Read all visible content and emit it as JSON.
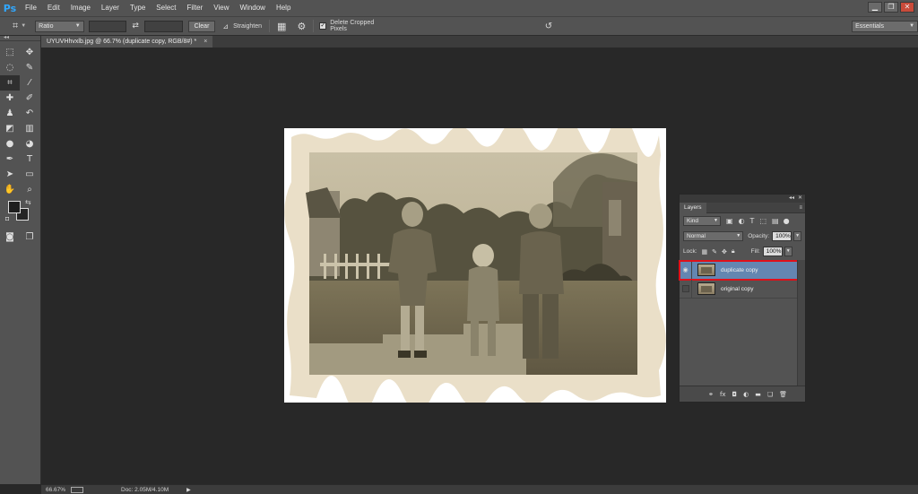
{
  "app": {
    "logo": "Ps"
  },
  "menu": [
    "File",
    "Edit",
    "Image",
    "Layer",
    "Type",
    "Select",
    "Filter",
    "View",
    "Window",
    "Help"
  ],
  "window_controls": {
    "minimize": "▁",
    "restore": "❐",
    "close": "✕"
  },
  "options": {
    "ratio_label": "Ratio",
    "clear_label": "Clear",
    "straighten_label": "Straighten",
    "delete_cropped_label": "Delete Cropped Pixels",
    "delete_cropped_checked": true,
    "workspace_label": "Essentials"
  },
  "document": {
    "tab_title": "UYUVHhvxlb.jpg @ 66.7% (duplicate copy, RGB/8#) *",
    "tab_close": "×"
  },
  "status": {
    "zoom": "66.67%",
    "doc_size": "Doc: 2.05M/4.10M"
  },
  "layers_panel": {
    "tab_label": "Layers",
    "filter_kind": "Kind",
    "blend_mode": "Normal",
    "opacity_label": "Opacity:",
    "opacity_value": "100%",
    "lock_label": "Lock:",
    "fill_label": "Fill:",
    "fill_value": "100%",
    "layers": [
      {
        "name": "duplicate copy",
        "visible": true,
        "selected": true
      },
      {
        "name": "original copy",
        "visible": false,
        "selected": false
      }
    ]
  },
  "colors": {
    "ui_dark": "#282828",
    "panel": "#535353",
    "selection": "#6486b1",
    "highlight_outline": "#e0101a"
  }
}
